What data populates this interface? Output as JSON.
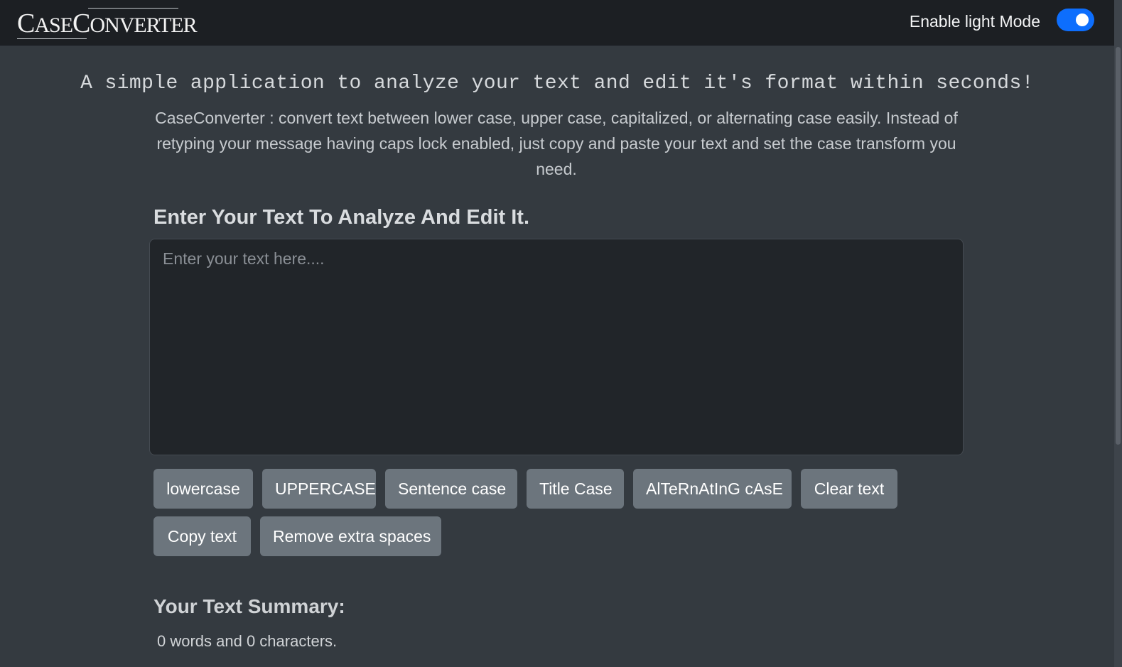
{
  "header": {
    "brand": "CaseConverter",
    "mode_label": "Enable light Mode",
    "toggle_state": "on",
    "accent_color": "#0d6efd"
  },
  "hero": {
    "title": "A simple application to analyze your text and edit it's format within seconds!",
    "description": "CaseConverter : convert text between lower case, upper case, capitalized, or alternating case easily. Instead of retyping your message having caps lock enabled, just copy and paste your text and set the case transform you need."
  },
  "editor": {
    "heading": "Enter Your Text To Analyze And Edit It.",
    "value": "",
    "placeholder": "Enter your text here...."
  },
  "buttons": {
    "lowercase": "lowercase",
    "uppercase": "UPPERCASE",
    "sentence_case": "Sentence case",
    "title_case": "Title Case",
    "alternating_case": "AlTeRnAtInG cAsE",
    "clear_text": "Clear text",
    "copy_text": "Copy text",
    "remove_extra_spaces": "Remove extra spaces"
  },
  "summary": {
    "heading": "Your Text Summary:",
    "line1": "0 words and 0 characters."
  }
}
